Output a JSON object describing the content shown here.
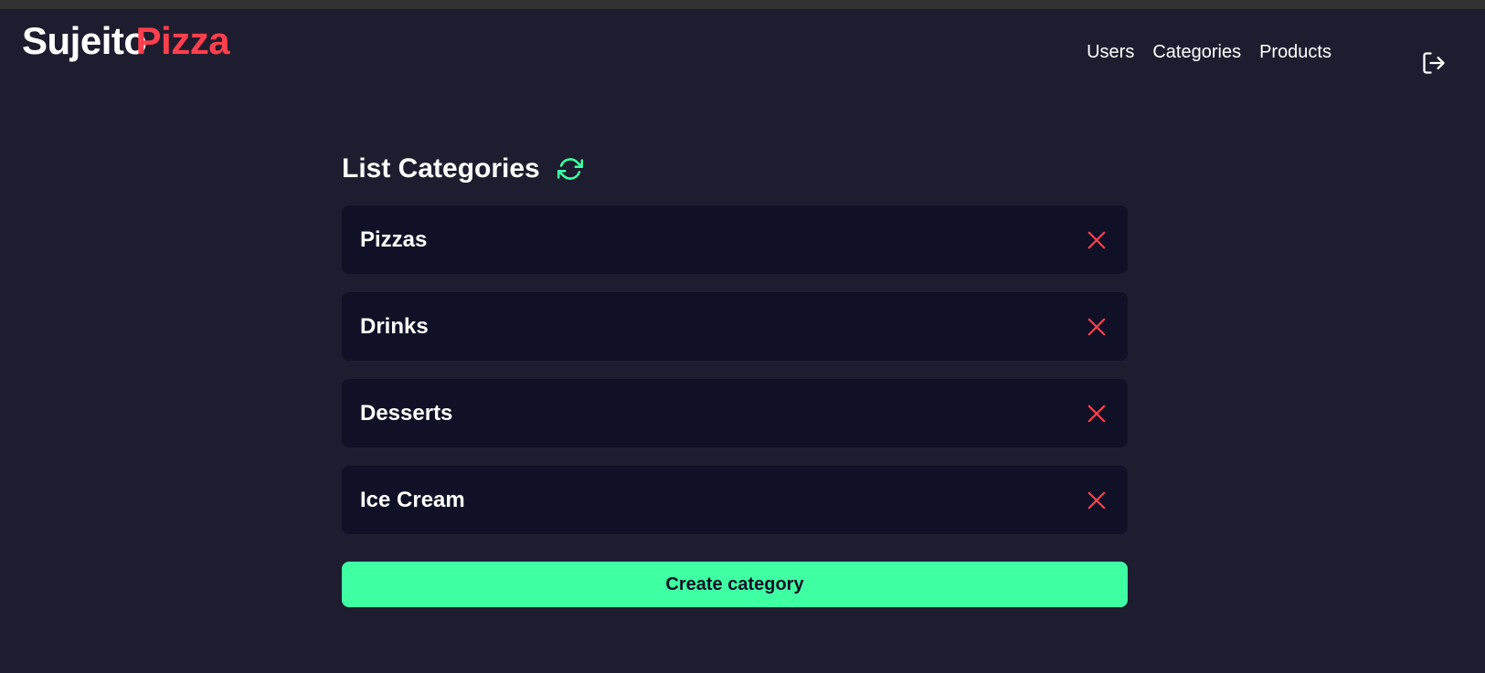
{
  "brand": {
    "part1": "Sujeito",
    "part2": "Pizza"
  },
  "nav": {
    "items": [
      {
        "label": "Users"
      },
      {
        "label": "Categories"
      },
      {
        "label": "Products"
      }
    ],
    "logout_icon": "logout-icon"
  },
  "main": {
    "title": "List Categories",
    "refresh_icon": "refresh-icon",
    "categories": [
      {
        "label": "Pizzas"
      },
      {
        "label": "Drinks"
      },
      {
        "label": "Desserts"
      },
      {
        "label": "Ice Cream"
      }
    ],
    "create_button": "Create category"
  },
  "colors": {
    "background": "#1e1d2f",
    "card": "#101026",
    "accent_red": "#ff3f4b",
    "accent_green": "#3fffa3",
    "text": "#ffffff"
  }
}
